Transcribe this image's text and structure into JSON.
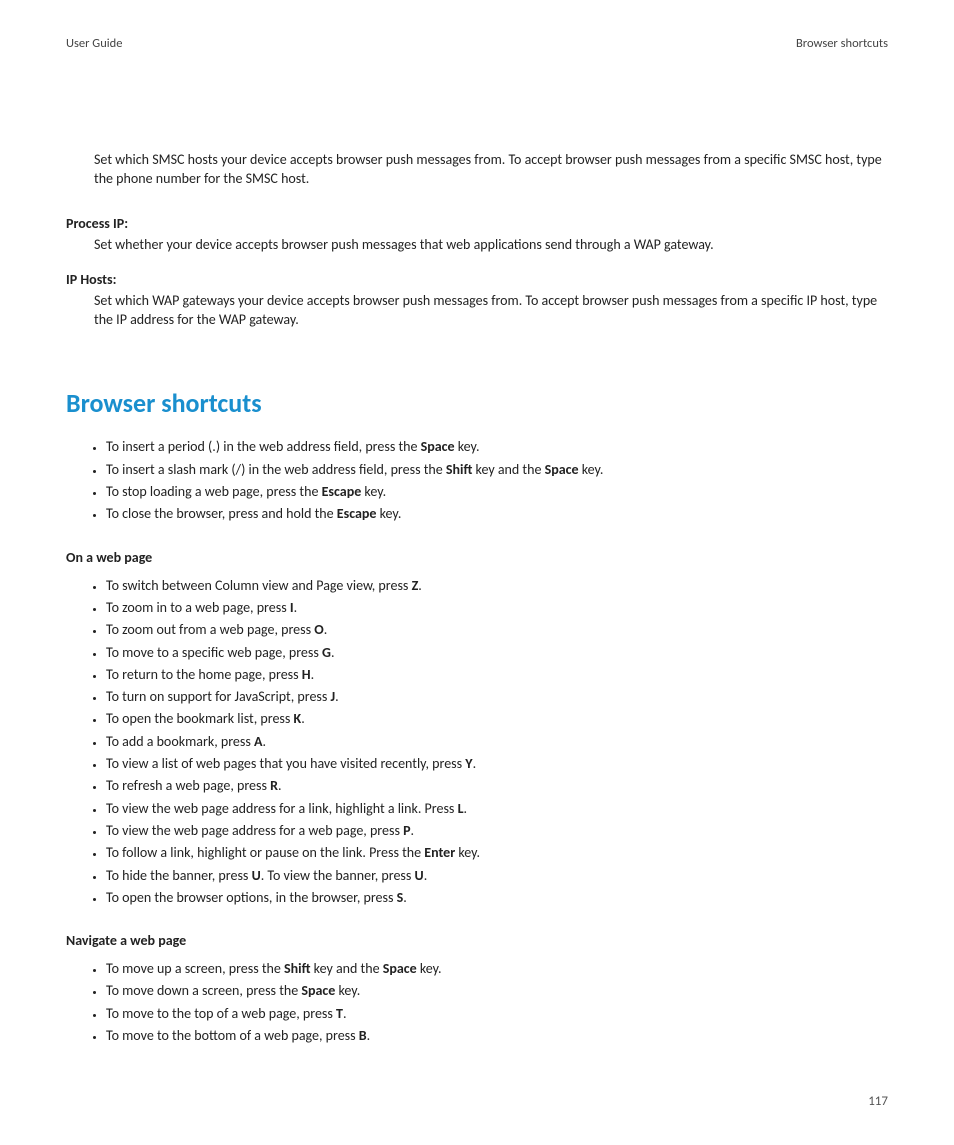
{
  "header": {
    "left": "User Guide",
    "right": "Browser shortcuts"
  },
  "intro_paragraph": {
    "parts": [
      {
        "t": "Set which SMSC hosts your device accepts browser push messages from. To accept browser push messages from a specific SMSC host, type the phone number for the SMSC host.",
        "b": false
      }
    ]
  },
  "defs": [
    {
      "label": "Process IP",
      "desc_parts": [
        {
          "t": "Set whether your device accepts browser push messages that web applications send through a WAP gateway.",
          "b": false
        }
      ]
    },
    {
      "label": "IP Hosts",
      "desc_parts": [
        {
          "t": "Set which WAP gateways your device accepts browser push messages from. To accept browser push messages from a specific IP host, type the IP address for the WAP gateway.",
          "b": false
        }
      ]
    }
  ],
  "section_title": "Browser shortcuts",
  "top_shortcuts": [
    [
      {
        "t": "To insert a period (.) in the web address field, press the ",
        "b": false
      },
      {
        "t": "Space",
        "b": true
      },
      {
        "t": " key.",
        "b": false
      }
    ],
    [
      {
        "t": "To insert a slash mark (/) in the web address field, press the ",
        "b": false
      },
      {
        "t": "Shift",
        "b": true
      },
      {
        "t": " key and the ",
        "b": false
      },
      {
        "t": "Space",
        "b": true
      },
      {
        "t": " key.",
        "b": false
      }
    ],
    [
      {
        "t": "To stop loading a web page, press the ",
        "b": false
      },
      {
        "t": "Escape",
        "b": true
      },
      {
        "t": " key.",
        "b": false
      }
    ],
    [
      {
        "t": "To close the browser, press and hold the ",
        "b": false
      },
      {
        "t": "Escape",
        "b": true
      },
      {
        "t": " key.",
        "b": false
      }
    ]
  ],
  "subheading_web": "On a web page",
  "web_shortcuts": [
    [
      {
        "t": "To switch between Column view and Page view, press ",
        "b": false
      },
      {
        "t": "Z",
        "b": true
      },
      {
        "t": ".",
        "b": false
      }
    ],
    [
      {
        "t": "To zoom in to a web page, press ",
        "b": false
      },
      {
        "t": "I",
        "b": true
      },
      {
        "t": ".",
        "b": false
      }
    ],
    [
      {
        "t": "To zoom out from a web page, press ",
        "b": false
      },
      {
        "t": "O",
        "b": true
      },
      {
        "t": ".",
        "b": false
      }
    ],
    [
      {
        "t": "To move to a specific web page, press ",
        "b": false
      },
      {
        "t": "G",
        "b": true
      },
      {
        "t": ".",
        "b": false
      }
    ],
    [
      {
        "t": "To return to the home page, press ",
        "b": false
      },
      {
        "t": "H",
        "b": true
      },
      {
        "t": ".",
        "b": false
      }
    ],
    [
      {
        "t": "To turn on support for JavaScript, press ",
        "b": false
      },
      {
        "t": "J",
        "b": true
      },
      {
        "t": ".",
        "b": false
      }
    ],
    [
      {
        "t": "To open the bookmark list, press ",
        "b": false
      },
      {
        "t": "K",
        "b": true
      },
      {
        "t": ".",
        "b": false
      }
    ],
    [
      {
        "t": "To add a bookmark, press ",
        "b": false
      },
      {
        "t": "A",
        "b": true
      },
      {
        "t": ".",
        "b": false
      }
    ],
    [
      {
        "t": "To view a list of web pages that you have visited recently, press ",
        "b": false
      },
      {
        "t": "Y",
        "b": true
      },
      {
        "t": ".",
        "b": false
      }
    ],
    [
      {
        "t": "To refresh a web page, press ",
        "b": false
      },
      {
        "t": "R",
        "b": true
      },
      {
        "t": ".",
        "b": false
      }
    ],
    [
      {
        "t": "To view the web page address for a link, highlight a link. Press ",
        "b": false
      },
      {
        "t": "L",
        "b": true
      },
      {
        "t": ".",
        "b": false
      }
    ],
    [
      {
        "t": "To view the web page address for a web page, press ",
        "b": false
      },
      {
        "t": "P",
        "b": true
      },
      {
        "t": ".",
        "b": false
      }
    ],
    [
      {
        "t": "To follow a link, highlight or pause on the link. Press the ",
        "b": false
      },
      {
        "t": "Enter",
        "b": true
      },
      {
        "t": " key.",
        "b": false
      }
    ],
    [
      {
        "t": "To hide the banner, press ",
        "b": false
      },
      {
        "t": "U",
        "b": true
      },
      {
        "t": ". To view the banner, press ",
        "b": false
      },
      {
        "t": "U",
        "b": true
      },
      {
        "t": ".",
        "b": false
      }
    ],
    [
      {
        "t": "To open the browser options, in the browser, press ",
        "b": false
      },
      {
        "t": "S",
        "b": true
      },
      {
        "t": ".",
        "b": false
      }
    ]
  ],
  "subheading_nav": "Navigate a web page",
  "nav_shortcuts": [
    [
      {
        "t": "To move up a screen, press the ",
        "b": false
      },
      {
        "t": "Shift",
        "b": true
      },
      {
        "t": " key and the ",
        "b": false
      },
      {
        "t": "Space",
        "b": true
      },
      {
        "t": " key.",
        "b": false
      }
    ],
    [
      {
        "t": "To move down a screen, press the ",
        "b": false
      },
      {
        "t": "Space",
        "b": true
      },
      {
        "t": " key.",
        "b": false
      }
    ],
    [
      {
        "t": "To move to the top of a web page, press ",
        "b": false
      },
      {
        "t": "T",
        "b": true
      },
      {
        "t": ".",
        "b": false
      }
    ],
    [
      {
        "t": "To move to the bottom of a web page, press ",
        "b": false
      },
      {
        "t": "B",
        "b": true
      },
      {
        "t": ".",
        "b": false
      }
    ]
  ],
  "page_number": "117"
}
